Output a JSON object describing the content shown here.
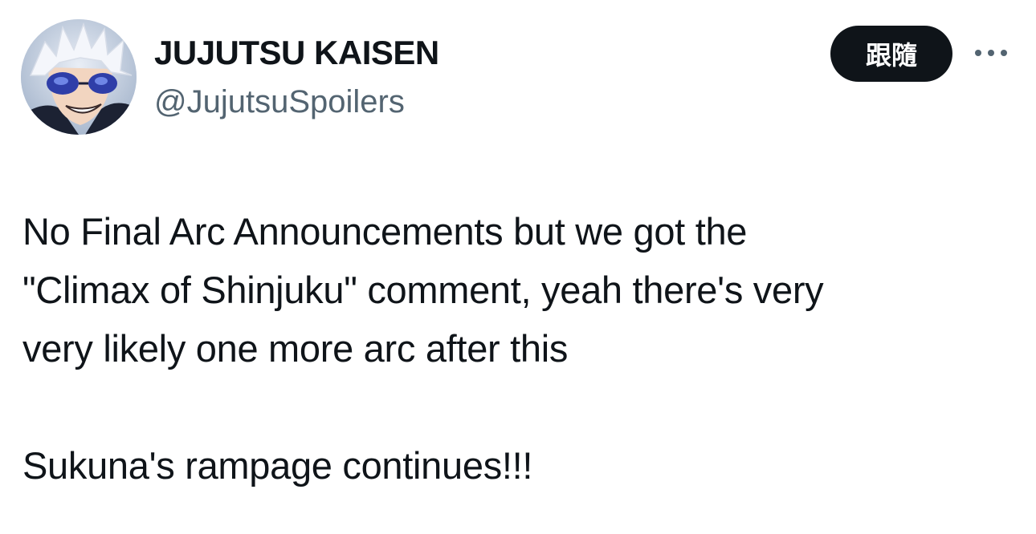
{
  "tweet": {
    "author": {
      "display_name": "JUJUTSU KAISEN",
      "handle": "@JujutsuSpoilers",
      "avatar": "anime-character-avatar"
    },
    "follow_label": "跟隨",
    "more_icon": "more-horizontal-icon",
    "body": "No Final Arc Announcements but we got the\n\"Climax of Shinjuku\" comment, yeah there's very\nvery likely one more arc after this\n\nSukuna's rampage continues!!!"
  },
  "colors": {
    "text_primary": "#0f1419",
    "text_secondary": "#536471",
    "follow_bg": "#0f1419",
    "follow_text": "#ffffff",
    "background": "#ffffff"
  }
}
